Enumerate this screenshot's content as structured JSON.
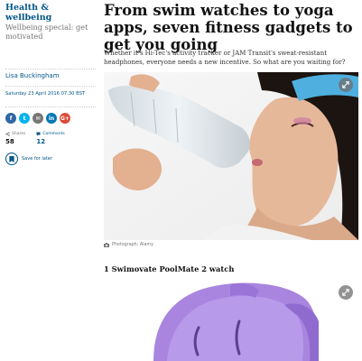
{
  "section": {
    "label": "Health & wellbeing",
    "series": "Wellbeing special: get motivated"
  },
  "article": {
    "headline": "From swim watches to yoga apps, seven fitness gadgets to get you going",
    "standfirst": "Whether it's Hi-Tec's activity tracker or JAM Transit's sweat-resistant headphones, everyone needs a new incentive. So what are you waiting for?",
    "byline": "Lisa Buckingham",
    "date": "Saturday 23 April 2016 07.30 BST"
  },
  "share": {
    "buttons": [
      {
        "name": "facebook",
        "glyph": "f",
        "color": "#3067a3"
      },
      {
        "name": "twitter",
        "glyph": "t",
        "color": "#03b3ee"
      },
      {
        "name": "email",
        "glyph": "✉",
        "color": "#767676"
      },
      {
        "name": "linkedin",
        "glyph": "in",
        "color": "#0077b5"
      },
      {
        "name": "googleplus",
        "glyph": "G+",
        "color": "#dc4a38"
      }
    ],
    "shares_label": "Shares",
    "shares_value": "58",
    "comments_label": "Comments",
    "comments_value": "12",
    "save_label": "Save for later"
  },
  "hero_image": {
    "caption": "Photograph: Alamy"
  },
  "items": [
    {
      "heading": "1 Swimovate PoolMate 2 watch"
    }
  ],
  "colors": {
    "brand_blue": "#005689",
    "headband": "#4fb0e0",
    "watch_purple": "#a985e0"
  }
}
